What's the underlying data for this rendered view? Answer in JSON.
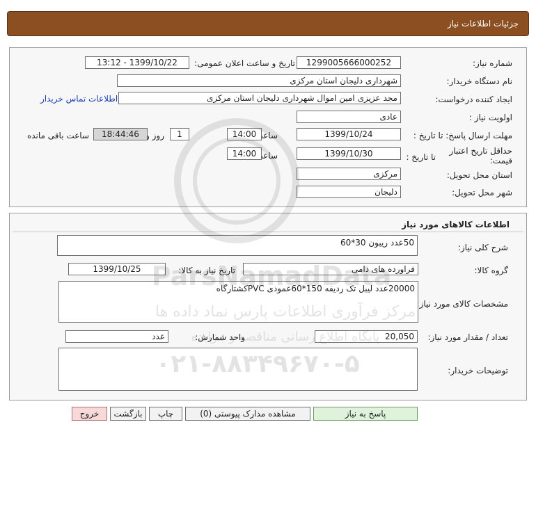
{
  "header": {
    "title": "جزئیات اطلاعات نیاز"
  },
  "info": {
    "need_number_label": "شماره نیاز:",
    "need_number": "1299005666000252",
    "announce_label": "تاریخ و ساعت اعلان عمومی:",
    "announce_value": "1399/10/22 - 13:12",
    "buyer_org_label": "نام دستگاه خریدار:",
    "buyer_org": "شهرداری دلیجان استان مرکزی",
    "requester_label": "ایجاد کننده درخواست:",
    "requester": "مجد عزیزی امین اموال شهرداری دلیجان استان مرکزی",
    "contact_link": "اطلاعات تماس خریدار",
    "priority_label": "اولویت نیاز :",
    "priority": "عادی",
    "reply_deadline_label": "مهلت ارسال پاسخ: تا تاریخ :",
    "reply_date": "1399/10/24",
    "hour_label": "ساعت",
    "reply_hour": "14:00",
    "days_value": "1",
    "days_label": "روز و",
    "remaining_time": "18:44:46",
    "remaining_label": "ساعت باقی مانده",
    "price_validity_label": "حداقل تاریخ اعتبار قیمت:",
    "until_date_label": "تا تاریخ :",
    "validity_date": "1399/10/30",
    "validity_hour_label": "ساعت",
    "validity_hour": "14:00",
    "province_label": "استان محل تحویل:",
    "province": "مرکزی",
    "city_label": "شهر محل تحویل:",
    "city": "دلیجان"
  },
  "goods": {
    "section_title": "اطلاعات کالاهای مورد نیاز",
    "summary_label": "شرح کلی نیاز:",
    "summary": "50عدد ریبون 30*60",
    "group_label": "گروه کالا:",
    "group": "فراورده های دامی",
    "need_date_label": "تاریخ نیاز به کالا:",
    "need_date": "1399/10/25",
    "specs_label": "مشخصات کالای مورد نیاز:",
    "specs": "20000عدد لیبل تک ردیفه 150*60عمودی PVCکشتارگاه",
    "quantity_label": "تعداد / مقدار مورد نیاز:",
    "quantity": "20,050",
    "unit_label": "واحد شمارش:",
    "unit": "عدد",
    "buyer_notes_label": "توضیحات خریدار:",
    "buyer_notes": ""
  },
  "buttons": {
    "reply": "پاسخ به نیاز",
    "attachments": "مشاهده مدارک پیوستی (0)",
    "print": "چاپ",
    "back": "بازگشت",
    "exit": "خروج"
  },
  "watermark": {
    "brand": "ParsNamadData",
    "line1": "مرکز فرآوری اطلاعات پارس نماد داده ها",
    "line2": "پایگاه اطلاع رسانی مناقصه و مزایده",
    "phone": "۰۲۱-۸۸۳۴۹۶۷۰-۵"
  }
}
